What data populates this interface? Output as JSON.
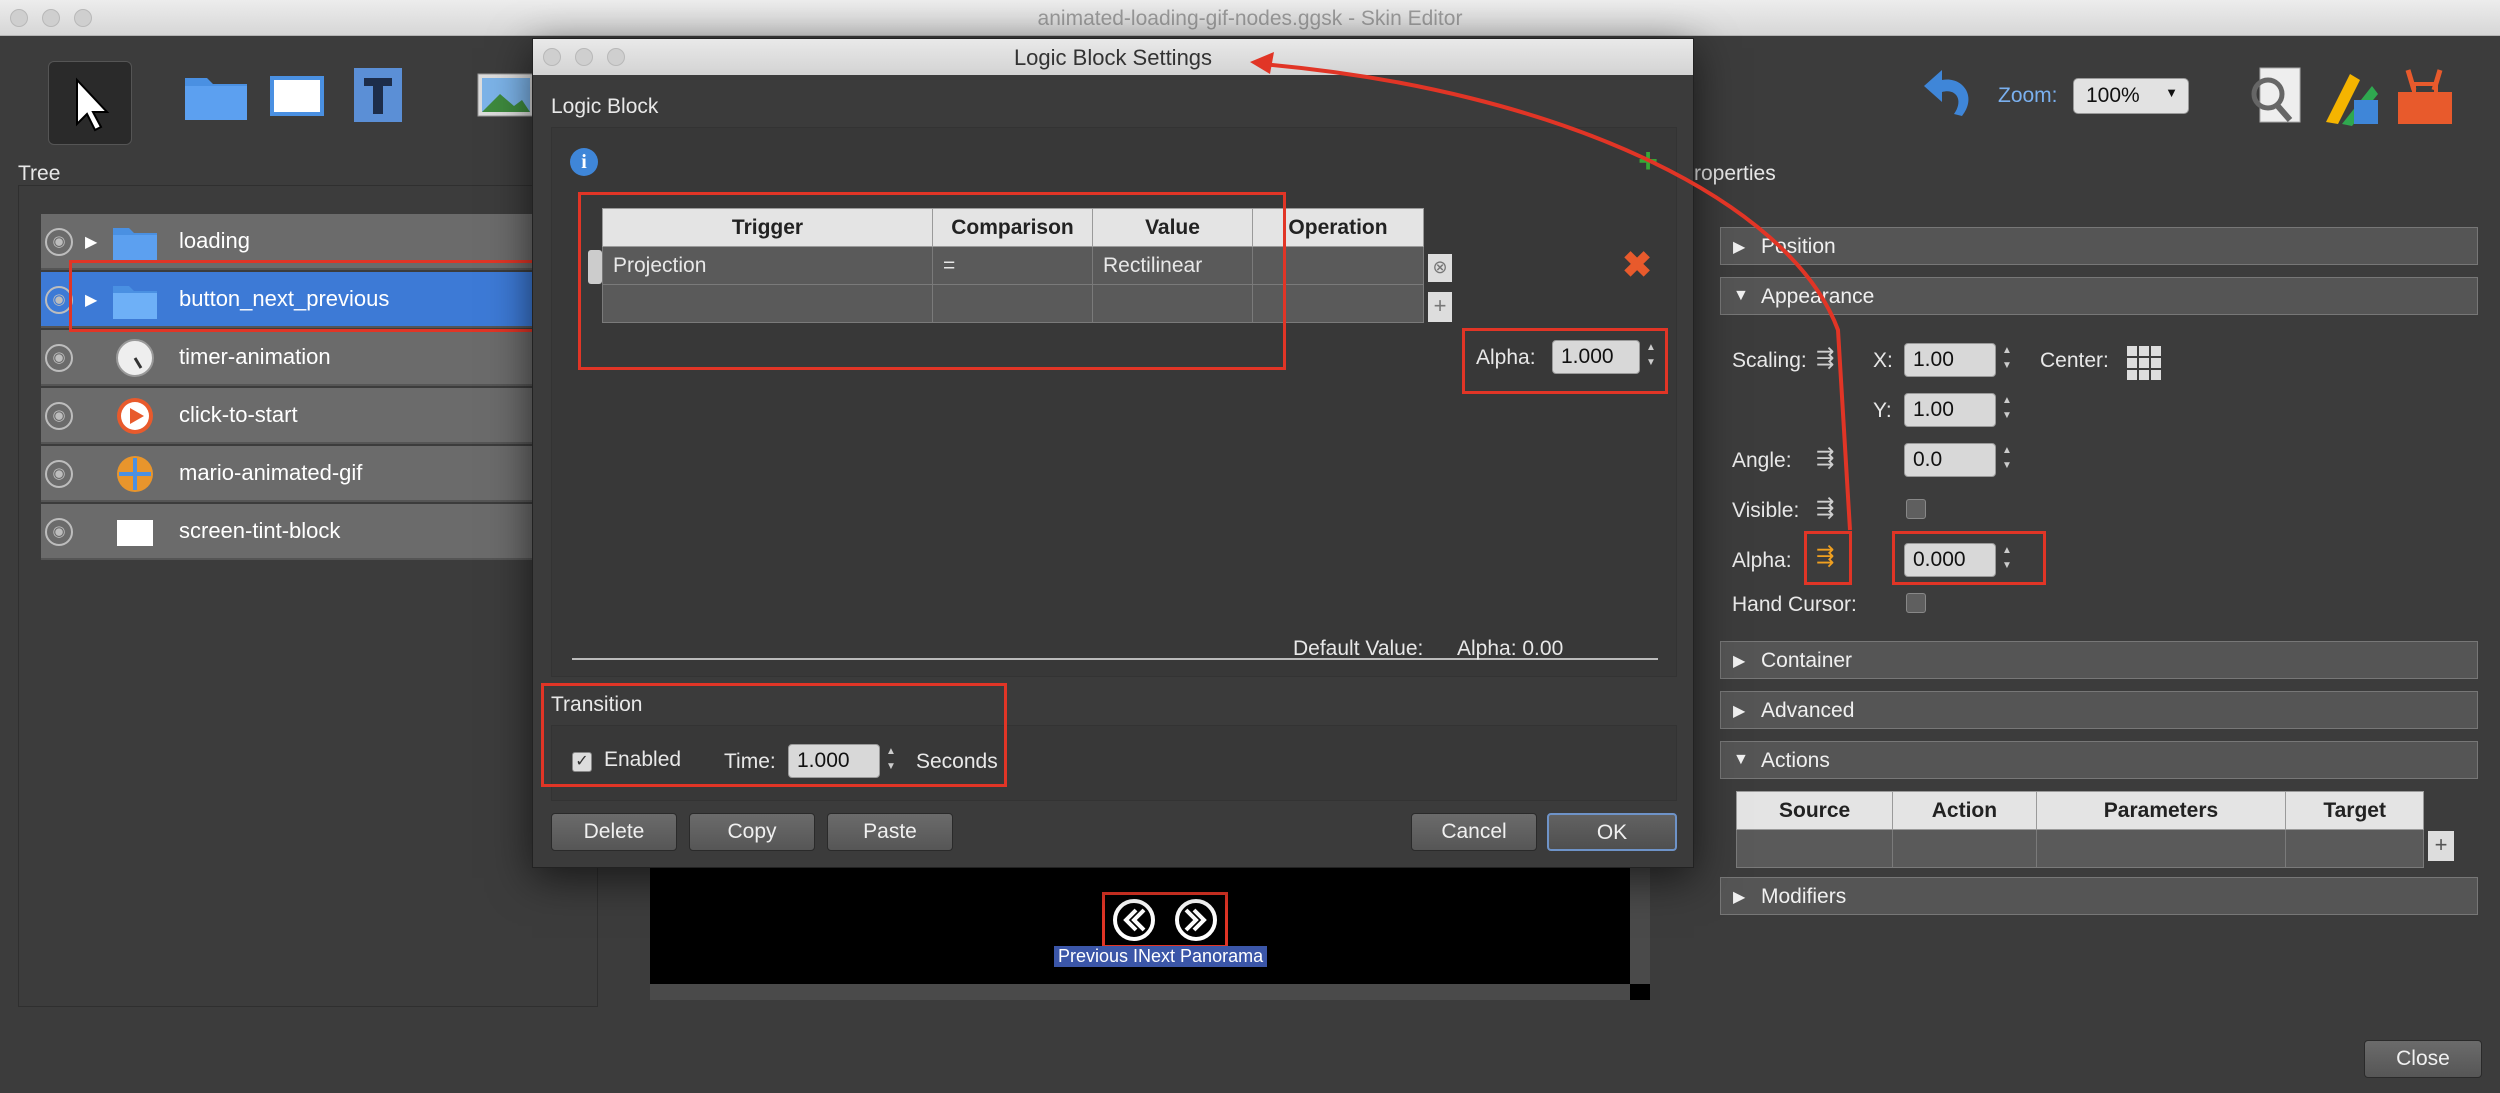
{
  "window": {
    "title": "animated-loading-gif-nodes.ggsk - Skin Editor"
  },
  "toolbar": {
    "zoom_label": "Zoom:",
    "zoom_value": "100%"
  },
  "tree": {
    "title": "Tree",
    "items": [
      {
        "name": "loading",
        "icon": "folder-icon"
      },
      {
        "name": "button_next_previous",
        "icon": "folder-icon",
        "selected": true
      },
      {
        "name": "timer-animation",
        "icon": "timer-icon"
      },
      {
        "name": "click-to-start",
        "icon": "play-icon"
      },
      {
        "name": "mario-animated-gif",
        "icon": "image-icon"
      },
      {
        "name": "screen-tint-block",
        "icon": "rectangle-icon"
      }
    ]
  },
  "preview": {
    "text": "Previous INext Panorama"
  },
  "dialog": {
    "title": "Logic Block Settings",
    "logic_block_label": "Logic Block",
    "table": {
      "headers": [
        "Trigger",
        "Comparison",
        "Value",
        "Operation"
      ],
      "rows": [
        [
          "Projection",
          "=",
          "Rectilinear",
          ""
        ],
        [
          "",
          "",
          "",
          ""
        ]
      ]
    },
    "alpha_label": "Alpha:",
    "alpha_value": "1.000",
    "default_value_label": "Default Value:",
    "default_value": "Alpha:  0.00",
    "transition_label": "Transition",
    "enabled_label": "Enabled",
    "enabled": true,
    "time_label": "Time:",
    "time_value": "1.000",
    "seconds_label": "Seconds",
    "buttons": {
      "delete": "Delete",
      "copy": "Copy",
      "paste": "Paste",
      "cancel": "Cancel",
      "ok": "OK"
    }
  },
  "properties": {
    "title": "Properties",
    "sections": {
      "position": "Position",
      "appearance": "Appearance",
      "container": "Container",
      "advanced": "Advanced",
      "actions": "Actions",
      "modifiers": "Modifiers"
    },
    "scaling_label": "Scaling:",
    "x_label": "X:",
    "x_value": "1.00",
    "center_label": "Center:",
    "y_label": "Y:",
    "y_value": "1.00",
    "angle_label": "Angle:",
    "angle_value": "0.0",
    "visible_label": "Visible:",
    "alpha_label": "Alpha:",
    "alpha_value": "0.000",
    "hand_cursor_label": "Hand Cursor:",
    "actions_headers": [
      "Source",
      "Action",
      "Parameters",
      "Target"
    ]
  },
  "close_button": "Close",
  "colors": {
    "accent_red": "#e13526",
    "selection_blue": "#3d7ad6"
  }
}
